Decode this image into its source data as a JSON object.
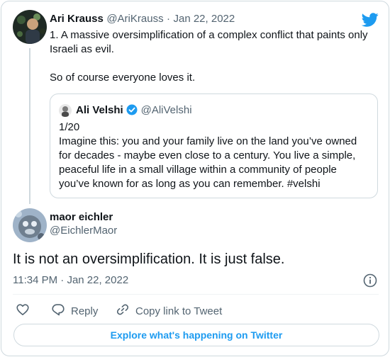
{
  "parent_tweet": {
    "display_name": "Ari Krauss",
    "handle": "@AriKrauss",
    "separator": "·",
    "date": "Jan 22, 2022",
    "text_line1": "1. A massive oversimplification of a complex conflict that paints only",
    "text_line2": "Israeli as evil.",
    "text_line3": "So of course everyone loves it."
  },
  "quoted_tweet": {
    "display_name": "Ali Velshi",
    "handle": "@AliVelshi",
    "counter": "1/20",
    "lines": [
      "Imagine this: you and your family live on the land you’ve owned",
      "for decades - maybe even close to a century. You live a simple,",
      "peaceful life in a small village within a community of people",
      "you’ve known for as long as you can remember. #velshi"
    ]
  },
  "main_tweet": {
    "display_name": "maor eichler",
    "handle": "@EichlerMaor",
    "text": "It is not an oversimplification. It is just false.",
    "time": "11:34 PM",
    "separator": "·",
    "date": "Jan 22, 2022"
  },
  "actions": {
    "reply_label": "Reply",
    "copy_label": "Copy link to Tweet"
  },
  "explore_label": "Explore what's happening on Twitter",
  "colors": {
    "accent": "#1d9bf0",
    "muted": "#536471",
    "border": "#cfd9de"
  },
  "icons": [
    "twitter-logo-icon",
    "verified-badge-icon",
    "info-icon",
    "heart-icon",
    "reply-icon",
    "link-icon"
  ]
}
